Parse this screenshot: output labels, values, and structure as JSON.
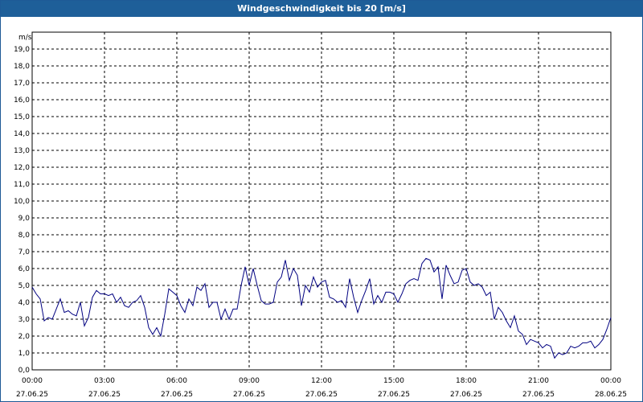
{
  "window": {
    "title": "Windgeschwindigkeit bis 20 [m/s]"
  },
  "chart_data": {
    "type": "line",
    "title": "Windgeschwindigkeit bis 20 [m/s]",
    "ylabel": "m/s",
    "xlabel": "",
    "ylim": [
      0,
      20
    ],
    "y_ticks": [
      "0,0",
      "1,0",
      "2,0",
      "3,0",
      "4,0",
      "5,0",
      "6,0",
      "7,0",
      "8,0",
      "9,0",
      "10,0",
      "11,0",
      "12,0",
      "13,0",
      "14,0",
      "15,0",
      "16,0",
      "17,0",
      "18,0",
      "19,0"
    ],
    "x_ticks": [
      {
        "time": "00:00",
        "date": "27.06.25"
      },
      {
        "time": "03:00",
        "date": "27.06.25"
      },
      {
        "time": "06:00",
        "date": "27.06.25"
      },
      {
        "time": "09:00",
        "date": "27.06.25"
      },
      {
        "time": "12:00",
        "date": "27.06.25"
      },
      {
        "time": "15:00",
        "date": "27.06.25"
      },
      {
        "time": "18:00",
        "date": "27.06.25"
      },
      {
        "time": "21:00",
        "date": "27.06.25"
      },
      {
        "time": "00:00",
        "date": "28.06.25"
      }
    ],
    "grid": true,
    "line_color": "#000080",
    "series": [
      {
        "x": [
          "00:00",
          "00:10",
          "00:20",
          "00:30",
          "00:40",
          "00:50",
          "01:00",
          "01:10",
          "01:20",
          "01:30",
          "01:40",
          "01:50",
          "02:00",
          "02:10",
          "02:20",
          "02:30",
          "02:40",
          "02:50",
          "03:00",
          "03:10",
          "03:20",
          "03:30",
          "03:40",
          "03:50",
          "04:00",
          "04:10",
          "04:20",
          "04:30",
          "04:40",
          "04:50",
          "05:00",
          "05:10",
          "05:20",
          "05:30",
          "05:40",
          "05:50",
          "06:00",
          "06:10",
          "06:20",
          "06:30",
          "06:40",
          "06:50",
          "07:00",
          "07:10",
          "07:20",
          "07:30",
          "07:40",
          "07:50",
          "08:00",
          "08:10",
          "08:20",
          "08:30",
          "08:40",
          "08:50",
          "09:00",
          "09:10",
          "09:20",
          "09:30",
          "09:40",
          "09:50",
          "10:00",
          "10:10",
          "10:20",
          "10:30",
          "10:40",
          "10:50",
          "11:00",
          "11:10",
          "11:20",
          "11:30",
          "11:40",
          "11:50",
          "12:00",
          "12:10",
          "12:20",
          "12:30",
          "12:40",
          "12:50",
          "13:00",
          "13:10",
          "13:20",
          "13:30",
          "13:40",
          "13:50",
          "14:00",
          "14:10",
          "14:20",
          "14:30",
          "14:40",
          "14:50",
          "15:00",
          "15:10",
          "15:20",
          "15:30",
          "15:40",
          "15:50",
          "16:00",
          "16:10",
          "16:20",
          "16:30",
          "16:40",
          "16:50",
          "17:00",
          "17:10",
          "17:20",
          "17:30",
          "17:40",
          "17:50",
          "18:00",
          "18:10",
          "18:20",
          "18:30",
          "18:40",
          "18:50",
          "19:00",
          "19:10",
          "19:20",
          "19:30",
          "19:40",
          "19:50",
          "20:00",
          "20:10",
          "20:20",
          "20:30",
          "20:40",
          "20:50",
          "21:00",
          "21:10",
          "21:20",
          "21:30",
          "21:40",
          "21:50",
          "22:00",
          "22:10",
          "22:20",
          "22:30",
          "22:40",
          "22:50",
          "23:00",
          "23:10",
          "23:20",
          "23:30",
          "23:40",
          "23:50",
          "00:00"
        ],
        "values": [
          4.9,
          4.5,
          4.2,
          2.9,
          3.1,
          3.0,
          3.6,
          4.2,
          3.4,
          3.5,
          3.3,
          3.2,
          4.0,
          2.6,
          3.1,
          4.3,
          4.7,
          4.5,
          4.5,
          4.4,
          4.5,
          4.0,
          4.3,
          3.8,
          3.7,
          4.0,
          4.1,
          4.4,
          3.7,
          2.5,
          2.1,
          2.5,
          2.0,
          3.3,
          4.8,
          4.6,
          4.4,
          3.8,
          3.4,
          4.2,
          3.8,
          4.9,
          4.7,
          5.1,
          3.7,
          4.0,
          4.0,
          3.0,
          3.6,
          3.0,
          3.6,
          3.6,
          5.0,
          6.1,
          5.0,
          6.0,
          5.0,
          4.1,
          3.9,
          3.9,
          4.0,
          5.2,
          5.5,
          6.5,
          5.3,
          6.0,
          5.6,
          3.8,
          5.0,
          4.6,
          5.5,
          4.9,
          5.2,
          5.3,
          4.3,
          4.2,
          4.0,
          4.1,
          3.7,
          5.4,
          4.3,
          3.4,
          4.1,
          4.7,
          5.4,
          3.9,
          4.4,
          4.0,
          4.6,
          4.6,
          4.5,
          4.0,
          4.5,
          5.1,
          5.3,
          5.4,
          5.3,
          6.3,
          6.6,
          6.5,
          5.8,
          6.1,
          4.2,
          6.2,
          5.6,
          5.1,
          5.2,
          5.9,
          6.0,
          5.2,
          5.0,
          5.1,
          4.9,
          4.4,
          4.6,
          3.0,
          3.7,
          3.4,
          2.9,
          2.5,
          3.2,
          2.3,
          2.1,
          1.5,
          1.8,
          1.7,
          1.6,
          1.3,
          1.5,
          1.4,
          0.7,
          1.0,
          0.9,
          1.0,
          1.4,
          1.3,
          1.4,
          1.6,
          1.6,
          1.7,
          1.3,
          1.5,
          1.8,
          2.4,
          3.1
        ]
      }
    ]
  }
}
